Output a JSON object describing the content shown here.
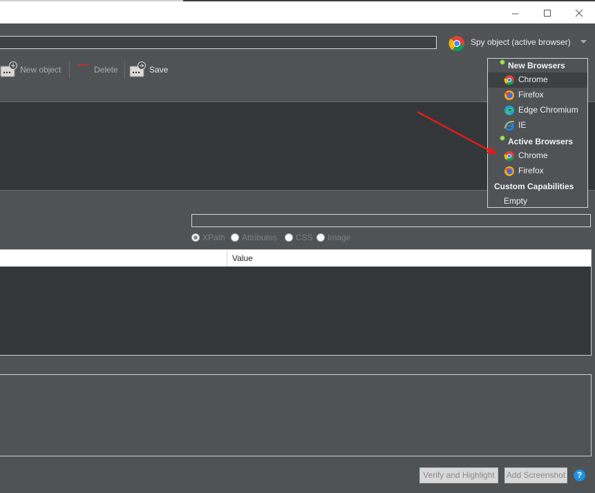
{
  "window": {
    "minimize_symbol": "—",
    "maximize_symbol": "☐",
    "close_symbol": "✕"
  },
  "url_bar": {
    "value": ""
  },
  "spy_button": {
    "label": "Spy object (active browser)",
    "icon": "chrome-icon"
  },
  "toolbar": {
    "new_object": "New object",
    "delete": "Delete",
    "save": "Save"
  },
  "locator": {
    "value": "",
    "options": [
      {
        "label": "XPath",
        "checked": true
      },
      {
        "label": "Attributes",
        "checked": false
      },
      {
        "label": "CSS",
        "checked": false
      },
      {
        "label": "Image",
        "checked": false
      }
    ]
  },
  "properties_table": {
    "columns": [
      "",
      "Value"
    ]
  },
  "buttons": {
    "verify": "Verify and Highlight",
    "screenshot": "Add Screenshot",
    "help": "?"
  },
  "browser_menu": {
    "new_browsers_header": "New Browsers",
    "new_browsers": [
      {
        "label": "Chrome",
        "icon": "chrome-icon"
      },
      {
        "label": "Firefox",
        "icon": "firefox-icon"
      },
      {
        "label": "Edge Chromium",
        "icon": "edge-icon"
      },
      {
        "label": "IE",
        "icon": "ie-icon"
      }
    ],
    "active_browsers_header": "Active Browsers",
    "active_browsers": [
      {
        "label": "Chrome",
        "icon": "chrome-icon"
      },
      {
        "label": "Firefox",
        "icon": "firefox-icon"
      }
    ],
    "custom_header": "Custom Capabilities",
    "custom_empty": "Empty"
  },
  "colors": {
    "background": "#4f5355",
    "panel": "#333739",
    "accent_arrow": "#e01b1b",
    "help_blue": "#1e90e0"
  }
}
